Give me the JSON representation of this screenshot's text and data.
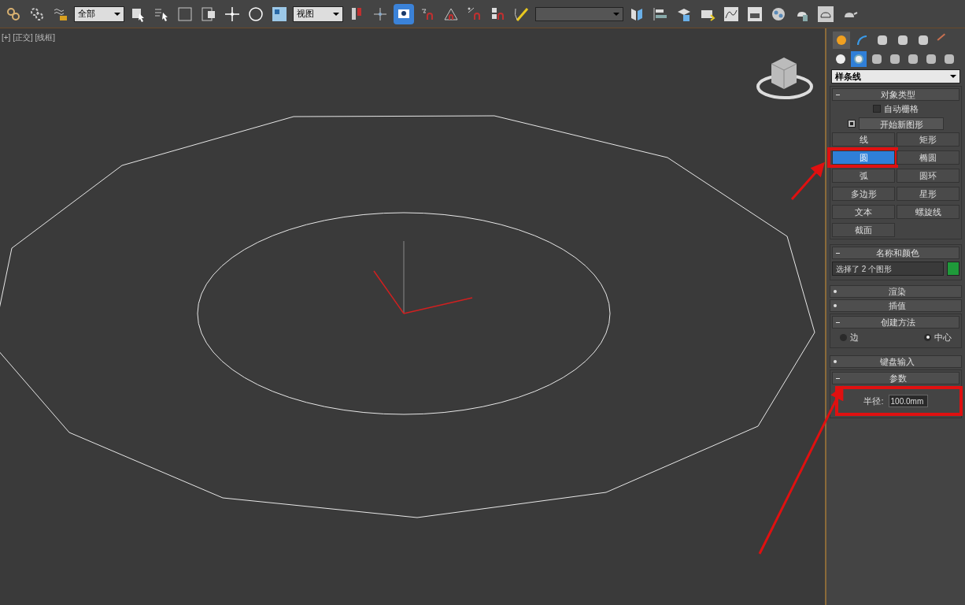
{
  "toolbar": {
    "filter_dropdown": "全部",
    "coord_dropdown": "视图",
    "keyboard_override_on": true
  },
  "viewport": {
    "label": "[+] [正交] [线框]"
  },
  "command_panel": {
    "tabs": [
      {
        "selected": true
      },
      {
        "selected": false
      },
      {
        "selected": false
      },
      {
        "selected": false
      },
      {
        "selected": false
      },
      {
        "selected": false
      }
    ],
    "categories": [
      {
        "selected": false
      },
      {
        "selected": true
      },
      {
        "selected": false
      },
      {
        "selected": false
      },
      {
        "selected": false
      },
      {
        "selected": false
      },
      {
        "selected": false
      }
    ],
    "type_dropdown": "样条线",
    "object_type": {
      "title": "对象类型",
      "auto_grid": {
        "label": "自动栅格",
        "checked": false
      },
      "start_new_shape": {
        "label": "开始新图形",
        "checked": true
      },
      "buttons": [
        {
          "label": "线",
          "selected": false
        },
        {
          "label": "矩形",
          "selected": false
        },
        {
          "label": "圆",
          "selected": true
        },
        {
          "label": "椭圆",
          "selected": false
        },
        {
          "label": "弧",
          "selected": false
        },
        {
          "label": "圆环",
          "selected": false
        },
        {
          "label": "多边形",
          "selected": false
        },
        {
          "label": "星形",
          "selected": false
        },
        {
          "label": "文本",
          "selected": false
        },
        {
          "label": "螺旋线",
          "selected": false
        },
        {
          "label": "截面",
          "selected": false
        }
      ]
    },
    "name_color": {
      "title": "名称和颜色",
      "name": "选择了 2 个图形",
      "color": "#1f9a3a"
    },
    "rollouts": [
      {
        "title": "渲染",
        "expanded": false
      },
      {
        "title": "插值",
        "expanded": false
      }
    ],
    "creation_method": {
      "title": "创建方法",
      "options": [
        {
          "label": "边",
          "selected": false
        },
        {
          "label": "中心",
          "selected": true
        }
      ]
    },
    "keyboard_rollout": {
      "title": "键盘输入",
      "expanded": false
    },
    "parameters": {
      "title": "参数",
      "radius_label": "半径:",
      "radius_value": "100.0mm"
    }
  }
}
